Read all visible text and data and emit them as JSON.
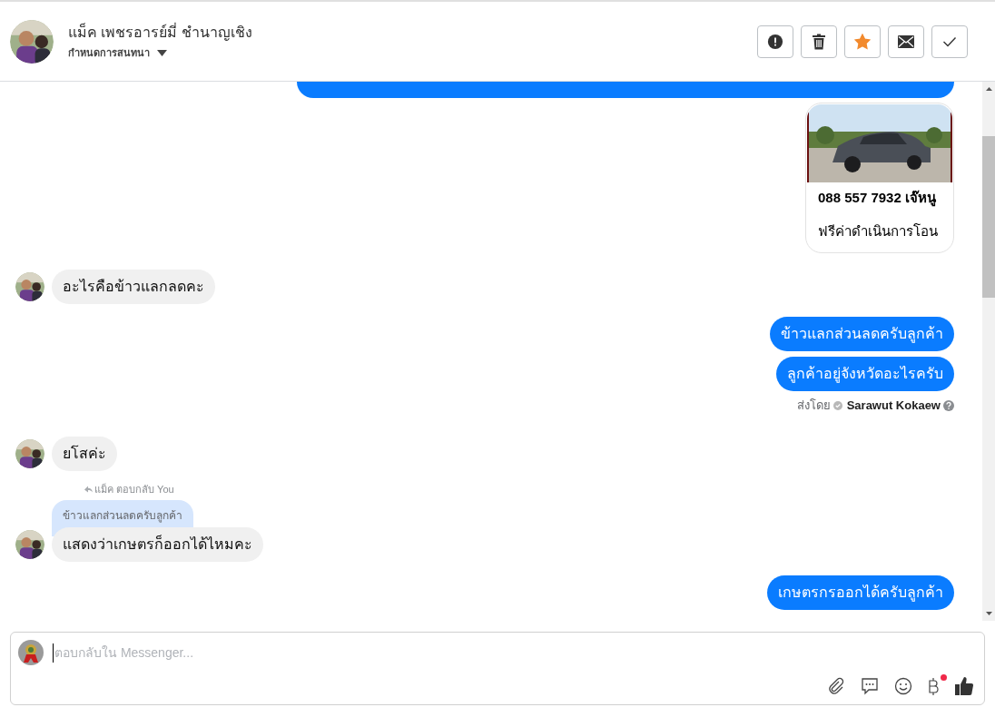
{
  "header": {
    "name": "แม็ค เพชรอารย์มี่ ชำนาญเชิง",
    "subtitle": "กำหนดการสนทนา"
  },
  "actions": [
    {
      "kind": "alert"
    },
    {
      "kind": "trash"
    },
    {
      "kind": "star"
    },
    {
      "kind": "mail"
    },
    {
      "kind": "check"
    }
  ],
  "starred": true,
  "messages": [
    {
      "kind": "cut"
    },
    {
      "kind": "card",
      "title": "088 557 7932 เจ๊หนู",
      "subtitle": "ฟรีค่าดำเนินการโอน"
    },
    {
      "kind": "incoming",
      "text": "อะไรคือข้าวแลกลดคะ"
    },
    {
      "kind": "outgoing",
      "text": "ข้าวแลกส่วนลดครับลูกค้า"
    },
    {
      "kind": "outgoing",
      "text": "ลูกค้าอยู่จังหวัดอะไรครับ"
    },
    {
      "kind": "sent_by",
      "label": "ส่งโดย",
      "agent": "Sarawut Kokaew"
    },
    {
      "kind": "incoming",
      "text": "ยโสค่ะ"
    },
    {
      "kind": "reply",
      "note": "แม็ค ตอบกลับ You",
      "quote": "ข้าวแลกส่วนลดครับลูกค้า",
      "text": "แสดงว่าเกษตรก็ออกได้ไหมคะ"
    },
    {
      "kind": "outgoing",
      "text": "เกษตรกรออกได้ครับลูกค้า"
    }
  ],
  "composer": {
    "placeholder": "ตอบกลับใน Messenger...",
    "currency_badge": true
  }
}
